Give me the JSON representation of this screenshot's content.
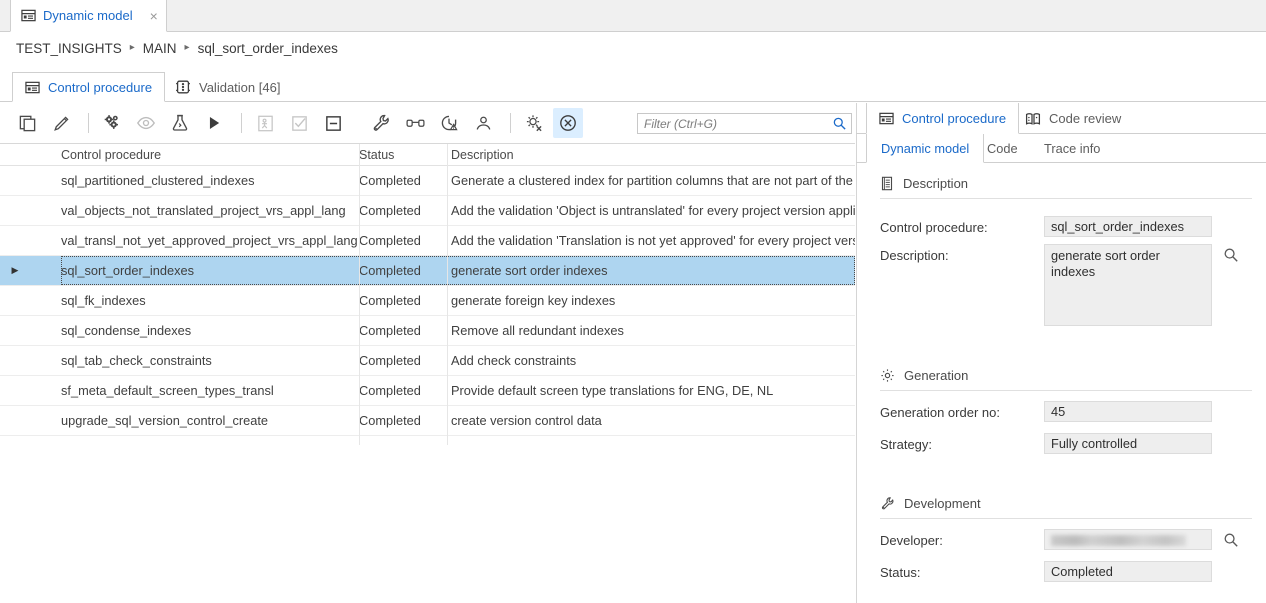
{
  "window": {
    "tab_label": "Dynamic model",
    "tab_icon": "dynamic-model-icon",
    "close_label": "×"
  },
  "breadcrumb": {
    "segments": [
      "TEST_INSIGHTS",
      "MAIN",
      "sql_sort_order_indexes"
    ],
    "separator": "▸"
  },
  "main_tabs": [
    {
      "label": "Control procedure",
      "icon": "control-procedure-icon",
      "active": true
    },
    {
      "label": "Validation [46]",
      "icon": "traffic-light-icon",
      "active": false
    }
  ],
  "toolbar": {
    "buttons": [
      {
        "name": "copy-icon",
        "title": "Copy",
        "enabled": true,
        "selected": false
      },
      {
        "name": "edit-pencil-icon",
        "title": "Edit",
        "enabled": true,
        "selected": false
      },
      {
        "name": "gears-icon",
        "title": "Generate",
        "enabled": true,
        "selected": false
      },
      {
        "name": "eye-icon",
        "title": "Preview",
        "enabled": false,
        "selected": false
      },
      {
        "name": "flask-icon",
        "title": "Test",
        "enabled": true,
        "selected": false
      },
      {
        "name": "play-icon",
        "title": "Run",
        "enabled": true,
        "selected": false
      },
      {
        "name": "impact-icon",
        "title": "Impact analysis",
        "enabled": false,
        "selected": false
      },
      {
        "name": "checkbox-icon",
        "title": "Check",
        "enabled": false,
        "selected": false
      },
      {
        "name": "minus-box-icon",
        "title": "Uncheck",
        "enabled": true,
        "selected": false
      },
      {
        "name": "wrench-icon",
        "title": "Maintenance",
        "enabled": true,
        "selected": false
      },
      {
        "name": "glasses-icon",
        "title": "Code review",
        "enabled": true,
        "selected": false
      },
      {
        "name": "clock-warning-icon",
        "title": "History",
        "enabled": true,
        "selected": false
      },
      {
        "name": "user-icon",
        "title": "Developer",
        "enabled": true,
        "selected": false
      },
      {
        "name": "settings-remove-icon",
        "title": "Reset settings",
        "enabled": true,
        "selected": false
      },
      {
        "name": "circle-x-icon",
        "title": "Cancel",
        "enabled": true,
        "selected": true
      }
    ]
  },
  "filter": {
    "placeholder": "Filter (Ctrl+G)",
    "value": "",
    "icon": "search-icon"
  },
  "grid": {
    "columns": [
      "Control procedure",
      "Status",
      "Description"
    ],
    "rows": [
      {
        "selected": false,
        "indicator": "",
        "name": "sql_partitioned_clustered_indexes",
        "status": "Completed",
        "description": "Generate a clustered index for partition columns that are not part of the def"
      },
      {
        "selected": false,
        "indicator": "",
        "name": "val_objects_not_translated_project_vrs_appl_lang",
        "status": "Completed",
        "description": "Add the validation 'Object is untranslated' for every project version applicat"
      },
      {
        "selected": false,
        "indicator": "",
        "name": "val_transl_not_yet_approved_project_vrs_appl_lang",
        "status": "Completed",
        "description": "Add the validation 'Translation is not yet approved' for every project version"
      },
      {
        "selected": true,
        "indicator": "▶",
        "name": "sql_sort_order_indexes",
        "status": "Completed",
        "description": "generate sort order indexes"
      },
      {
        "selected": false,
        "indicator": "",
        "name": "sql_fk_indexes",
        "status": "Completed",
        "description": "generate foreign key indexes"
      },
      {
        "selected": false,
        "indicator": "",
        "name": "sql_condense_indexes",
        "status": "Completed",
        "description": "Remove all redundant indexes"
      },
      {
        "selected": false,
        "indicator": "",
        "name": "sql_tab_check_constraints",
        "status": "Completed",
        "description": "Add check constraints"
      },
      {
        "selected": false,
        "indicator": "",
        "name": "sf_meta_default_screen_types_transl",
        "status": "Completed",
        "description": "Provide default screen type translations for ENG, DE, NL"
      },
      {
        "selected": false,
        "indicator": "",
        "name": "upgrade_sql_version_control_create",
        "status": "Completed",
        "description": "create version control data"
      }
    ]
  },
  "right_panel": {
    "tabs": [
      {
        "label": "Control procedure",
        "icon": "control-procedure-icon",
        "active": true
      },
      {
        "label": "Code review",
        "icon": "code-review-icon",
        "active": false
      }
    ],
    "subtabs": [
      {
        "label": "Dynamic model",
        "active": true
      },
      {
        "label": "Code",
        "active": false
      },
      {
        "label": "Trace info",
        "active": false
      }
    ],
    "sections": {
      "description": {
        "title": "Description",
        "icon": "document-icon",
        "control_procedure_label": "Control procedure:",
        "control_procedure_value": "sql_sort_order_indexes",
        "description_label": "Description:",
        "description_value": "generate sort order indexes",
        "search_icon": "search-icon"
      },
      "generation": {
        "title": "Generation",
        "icon": "gear-icon",
        "order_no_label": "Generation order no:",
        "order_no_value": "45",
        "strategy_label": "Strategy:",
        "strategy_value": "Fully controlled"
      },
      "development": {
        "title": "Development",
        "icon": "wrench-icon",
        "developer_label": "Developer:",
        "developer_value": "",
        "developer_redacted": true,
        "status_label": "Status:",
        "status_value": "Completed",
        "search_icon": "search-icon"
      }
    }
  },
  "colors": {
    "accent_blue": "#1b6ac9",
    "selection_blue": "#aed5f0",
    "toolbar_selected_bg": "#dbeeff",
    "field_bg": "#eeeeee",
    "border": "#cfcfcf"
  }
}
